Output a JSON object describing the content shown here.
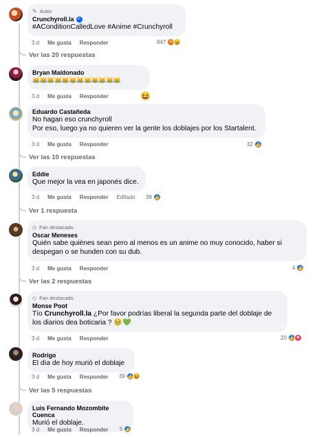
{
  "comments": [
    {
      "badge": "Autor",
      "author": "Crunchyroll.la",
      "verified": true,
      "text": "#AConditionCalledLove #Anime #Crunchyroll",
      "time": "3 d",
      "like": "Me gusta",
      "reply": "Responder",
      "count": "847",
      "replies": "Ver las 20 respuestas"
    },
    {
      "author": "Bryan Maldonado",
      "text": "😹😹😹😹😹😹😹😹😹😹😹😹",
      "extra_emoji": "😆",
      "time": "3 d",
      "like": "Me gusta",
      "reply": "Responder"
    },
    {
      "author": "Eduardo Castañeda",
      "text": "No hagan eso crunchyroll\nPor eso, luego ya no quieren ver la gente los doblajes por los Startalent.",
      "time": "3 d",
      "like": "Me gusta",
      "reply": "Responder",
      "count": "32",
      "replies": "Ver las 10 respuestas"
    },
    {
      "author": "Eddie",
      "text": "Que mejor la vea en japonés dice.",
      "time": "3 d",
      "like": "Me gusta",
      "reply": "Responder",
      "edited": "Editado",
      "count": "39",
      "replies": "Ver 1 respuesta"
    },
    {
      "badge": "Fan destacado",
      "author": "Oscar Meneses",
      "text": "Quién sabe quiénes sean pero al menos es un anime no muy conocido, haber si despegan o se hunden con su dub.",
      "time": "3 d",
      "like": "Me gusta",
      "reply": "Responder",
      "count": "4",
      "replies": "Ver las 2 respuestas"
    },
    {
      "badge": "Fan destacado",
      "author": "Monse Poot",
      "text_prefix": "Tío ",
      "text_mention": "Crunchyroll.la",
      "text_rest": " ¿Por favor podrías liberal la segunda parte del doblaje de los diarios dea boticaria ? 🥹💚",
      "time": "3 d",
      "like": "Me gusta",
      "reply": "Responder",
      "count": "20"
    },
    {
      "author": "Rodrigo",
      "text": "El día de hoy murió el doblaje",
      "time": "3 d",
      "like": "Me gusta",
      "reply": "Responder",
      "count": "39",
      "replies": "Ver las 5 respuestas"
    },
    {
      "author": "Luis Fernando Mozombite Cuenca",
      "text": "Murió el doblaje.",
      "time": "3 d",
      "like": "Me gusta",
      "reply": "Responder",
      "count": "5"
    }
  ],
  "colors": {
    "like": "#1877f2",
    "haha": "#f7b125",
    "love": "#f33e58",
    "angry": "#e9710f",
    "bubble": "#f0f2f5",
    "meta": "#65676b"
  },
  "icons": {
    "badge_author": "pencil-icon",
    "badge_fan": "diamond-icon",
    "verified": "verified-badge-icon"
  }
}
